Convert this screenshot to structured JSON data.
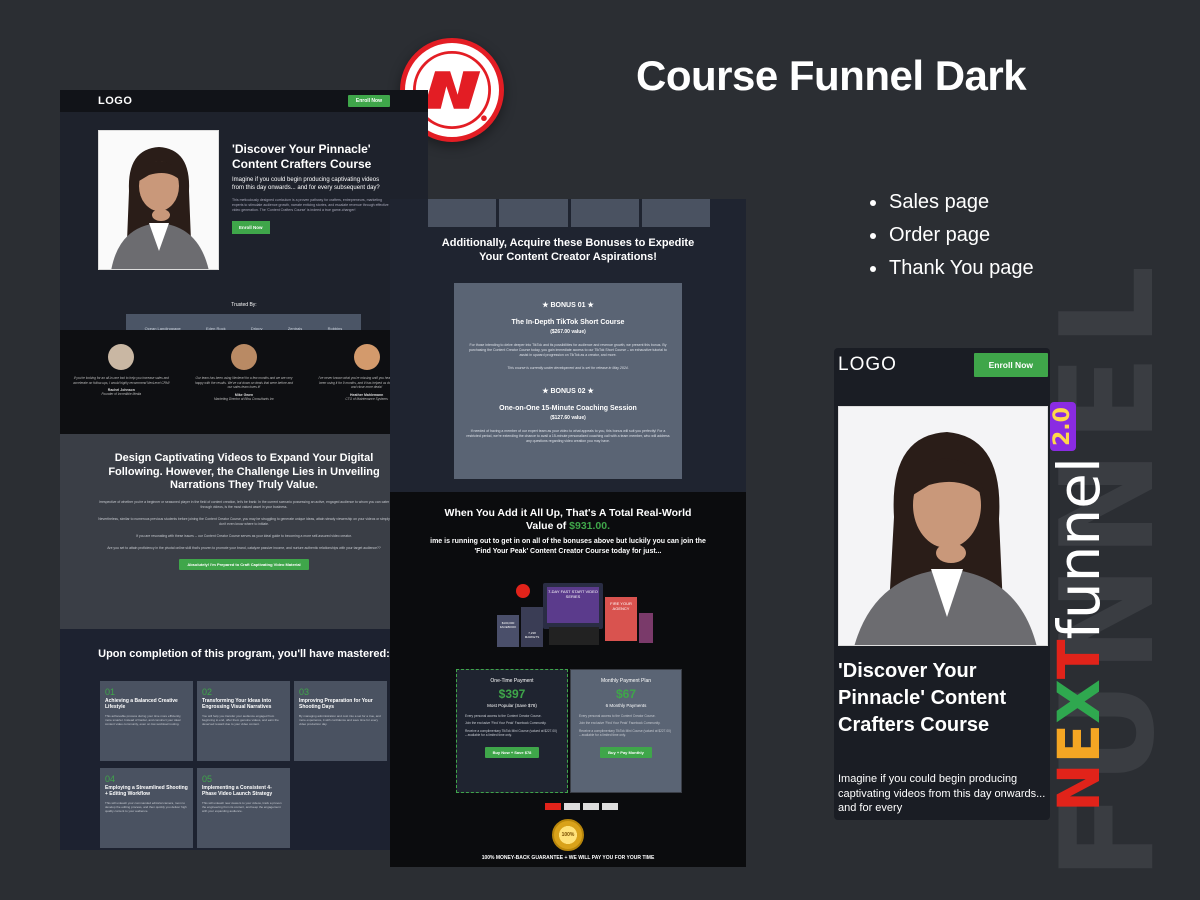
{
  "heading": "Course Funnel Dark",
  "features": [
    "Sales page",
    "Order page",
    "Thank You page"
  ],
  "brand": {
    "letters": [
      "N",
      "E",
      "X",
      "T"
    ],
    "word": "funnel",
    "version": "2.0",
    "ghost": "FUNNEL"
  },
  "sales_page": {
    "logo": "LOGO",
    "nav_button": "Enroll Now",
    "hero": {
      "title": "'Discover Your Pinnacle' Content Crafters Course",
      "subtitle": "Imagine if you could begin producing captivating videos from this day onwards... and for every subsequent day?",
      "body": "This meticulously designed curriculum is a proven pathway for crafters, entrepreneurs, marketing experts to stimulate audience growth, narrate enticing stories, and escalate revenue through effective video generation. The 'Content Crafters Course' is indeed a true game-changer!",
      "button": "Enroll Now"
    },
    "trusted_label": "Trusted By:",
    "trusted_logos": [
      "Ocean Landingpage",
      "Eden Rock",
      "Drippy",
      "Zentrals",
      "Robbins"
    ],
    "testimonials": [
      {
        "quote": "If you're looking for an all-in-one tool to help you increase sales and accelerate on follow-ups, I would highly recommend NexLevel CRM!",
        "name": "Rachel Johnson",
        "role": "Founder of Incredible Media"
      },
      {
        "quote": "Our team has been using Nexlevel for a few months and we are very happy with the results. We've cut down on deals that were before and our sales team loves it!",
        "name": "Mike Gwen",
        "role": "Marketing Director at Bliss Consultants Inc"
      },
      {
        "quote": "I've never known what you're missing until you hear Nexlevel. We've been using it for 9 months, and it has helped us double our pipeline and close more deals!",
        "name": "Heather Mahlemann",
        "role": "CTO of Maintenance Systems"
      }
    ],
    "design": {
      "title": "Design Captivating Videos to Expand Your Digital Following. However, the Challenge Lies in Unveiling Narrations They Truly Value.",
      "p1": "Irrespective of whether you're a beginner or seasoned player in the field of content creation, let's be frank: In the current scenario possessing an active, engaged audience to whom you can cater through videos, is the most valued asset in your business.",
      "p2": "Nevertheless, similar to numerous previous students before joining the Content Creator Course, you may be struggling to generate unique ideas, attain steady viewership on your videos or simply don't even know where to initiate.",
      "p3": "If you are resonating with these issues -- our Content Creator Course serves as your ideal guide to becoming a more self-assured video creator.",
      "p4": "Are you set to attain proficiency in the pivotal online skill that's proven to promote your brand, catalyze passive income, and nurture authentic relationships with your target audience??",
      "button": "Absolutely! I'm Prepared to Craft Captivating Video Material"
    },
    "mastered": {
      "title": "Upon completion of this program, you'll have mastered:",
      "items": [
        {
          "num": "01",
          "title": "Achieving a Balanced Creative Lifestyle",
          "desc": "This achievable process during your time more efficiently, more smarter. Instead of harder, and construct your ideal content video community, even on low workload routing."
        },
        {
          "num": "02",
          "title": "Transforming Your Ideas into Engrossing Visual Narratives",
          "desc": "You will help you transfer your audience engaged from beginning to end, offer them genuine videos, and earn the deserved reward due to your video content."
        },
        {
          "num": "03",
          "title": "Improving Preparation for Your Shooting Days",
          "desc": "By managing administration and cost into a set for a true, and more experience, it with confidence and save time for every video production day."
        },
        {
          "num": "04",
          "title": "Employing a Streamlined Shooting + Editing Workflow",
          "desc": "This will unleash your commanded editorial camera, room to develop the editing process, and then quickly you deliver high quality content to your audience."
        },
        {
          "num": "05",
          "title": "Implementing a Consistent 4-Phase Video Launch Strategy",
          "desc": "This will unleash new viewers to your videos, track a proven the engineering from its content, and keep the engagement with your expanding audience."
        }
      ]
    }
  },
  "order_page": {
    "bonus_heading": "Additionally, Acquire these Bonuses to Expedite Your Content Creator Aspirations!",
    "bonuses": [
      {
        "label": "★ BONUS 01 ★",
        "title": "The In-Depth TikTok Short Course",
        "value": "($267.00 value)",
        "desc": "For those intending to delve deeper into TikTok and its possibilities for audience and revenue growth, we present this bonus. By purchasing the Content Creator Course today, you gain immediate access to our TikTok Short Course – an exhaustive tutorial to assist in upward progression on TikTok as a creator, and more.",
        "note": "This course is currently under development and is set for release in May 2024."
      },
      {
        "label": "★ BONUS 02 ★",
        "title": "One-on-One 15-Minute Coaching Session",
        "value": "($127.60 value)",
        "desc": "If needed of having a member of our expert team as your video to what appeals to you, this bonus will suit you perfectly! For a restricted period, we're extending the chance to avail a 15-minute personalized coaching call with a team member, who will address any questions regarding video creation you may have."
      }
    ],
    "total_prefix": "When You Add it All Up, That's A Total Real-World Value of ",
    "total_value": "$931.00.",
    "urgency": "ime is running out to get in on all of the bonuses above but luckily you can join the 'Find Your Peak' Content Creator Course today for just...",
    "bundle": {
      "box1": "7-DAY FAST START VIDEO SERIES",
      "box2": "FIRE YOUR AGENCY",
      "box3": "$100,000 FACEBOOK",
      "box4": "7,238 MARKETS"
    },
    "plans": [
      {
        "type": "One-Time Payment",
        "price": "$397",
        "sub": "Most Popular (Save $78)",
        "features": [
          "Every personal access to the Content Creator Course.",
          "Join the exclusive 'Find Your Peak' Facebook Community.",
          "Receive a complimentary TikTok Mini Course (valued at $227.00) – available for a limited time only."
        ],
        "button": "Buy Now + Save $78"
      },
      {
        "type": "Monthly Payment Plan",
        "price": "$67",
        "sub": "6 Monthly Payments",
        "features": [
          "Every personal access to the Content Creator Course.",
          "Join the exclusive 'Find Your Peak' Facebook Community.",
          "Receive a complimentary TikTok Mini Course (valued at $227.00) – available for a limited time only."
        ],
        "button": "Buy + Pay Monthly"
      }
    ],
    "seal": "100%",
    "guarantee": "100% MONEY-BACK GUARANTEE + WE WILL PAY YOU FOR YOUR TIME"
  },
  "mobile_page": {
    "logo": "LOGO",
    "button": "Enroll Now",
    "title": "'Discover Your Pinnacle' Content Crafters Course",
    "subtitle": "Imagine if you could begin producing captivating videos from this day onwards... and for every"
  },
  "colors": {
    "accent": "#3fa64a",
    "brand_red": "#e1231a",
    "bg": "#2b2e33"
  }
}
